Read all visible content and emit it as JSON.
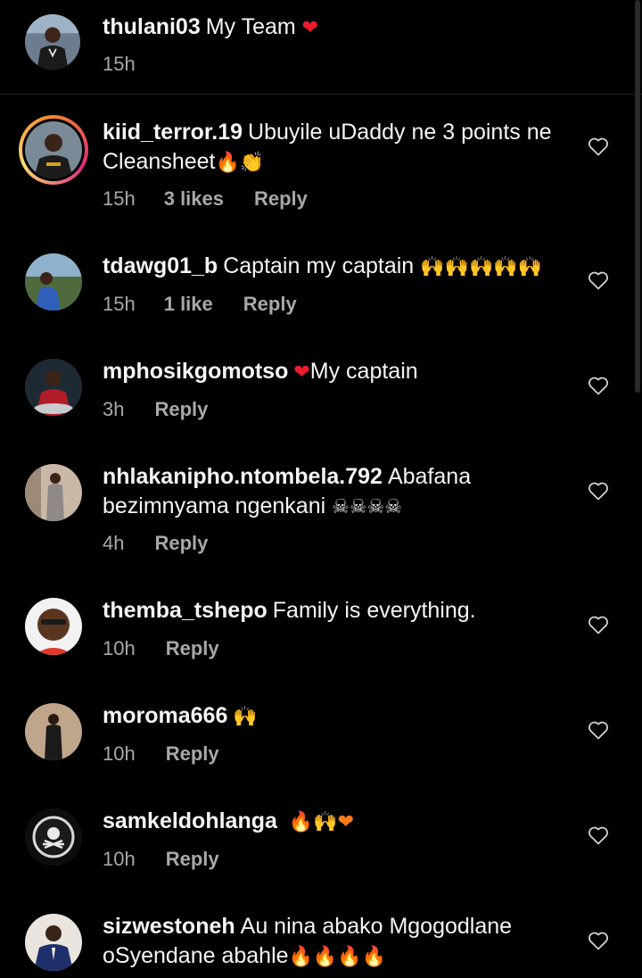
{
  "caption": {
    "username": "thulani03",
    "text": "My Team",
    "emoji": "❤",
    "time": "15h"
  },
  "comments": [
    {
      "username": "kiid_terror.19",
      "text": "Ubuyile uDaddy ne 3 points ne Cleansheet",
      "emoji": "🔥👏",
      "time": "15h",
      "likes": "3 likes",
      "reply": "Reply",
      "has_story": true
    },
    {
      "username": "tdawg01_b",
      "text": "Captain my captain",
      "emoji": "🙌🙌🙌🙌🙌",
      "time": "15h",
      "likes": "1 like",
      "reply": "Reply"
    },
    {
      "username": "mphosikgomotso",
      "text": "My captain",
      "emoji": "❤",
      "time": "3h",
      "reply": "Reply"
    },
    {
      "username": "nhlakanipho.ntombela.792",
      "text": "Abafana bezimnyama ngenkani",
      "emoji": "☠☠☠☠",
      "time": "4h",
      "reply": "Reply"
    },
    {
      "username": "themba_tshepo",
      "text": "Family is everything.",
      "time": "10h",
      "reply": "Reply"
    },
    {
      "username": "moroma666",
      "text": "",
      "emoji": "🙌",
      "time": "10h",
      "reply": "Reply"
    },
    {
      "username": "samkeldohlanga",
      "text": "",
      "emoji": "🔥🙌❤",
      "time": "10h",
      "reply": "Reply"
    },
    {
      "username": "sizwestoneh",
      "text": "Au nina abako Mgogodlane oSyendane abahle",
      "emoji": "🔥🔥🔥🔥"
    }
  ],
  "icons": {
    "like": "heart-outline-icon"
  },
  "colors": {
    "background": "#000000",
    "text": "#f5f5f5",
    "meta": "#a8a8a8",
    "heart_emoji": "#ee1b2e"
  }
}
